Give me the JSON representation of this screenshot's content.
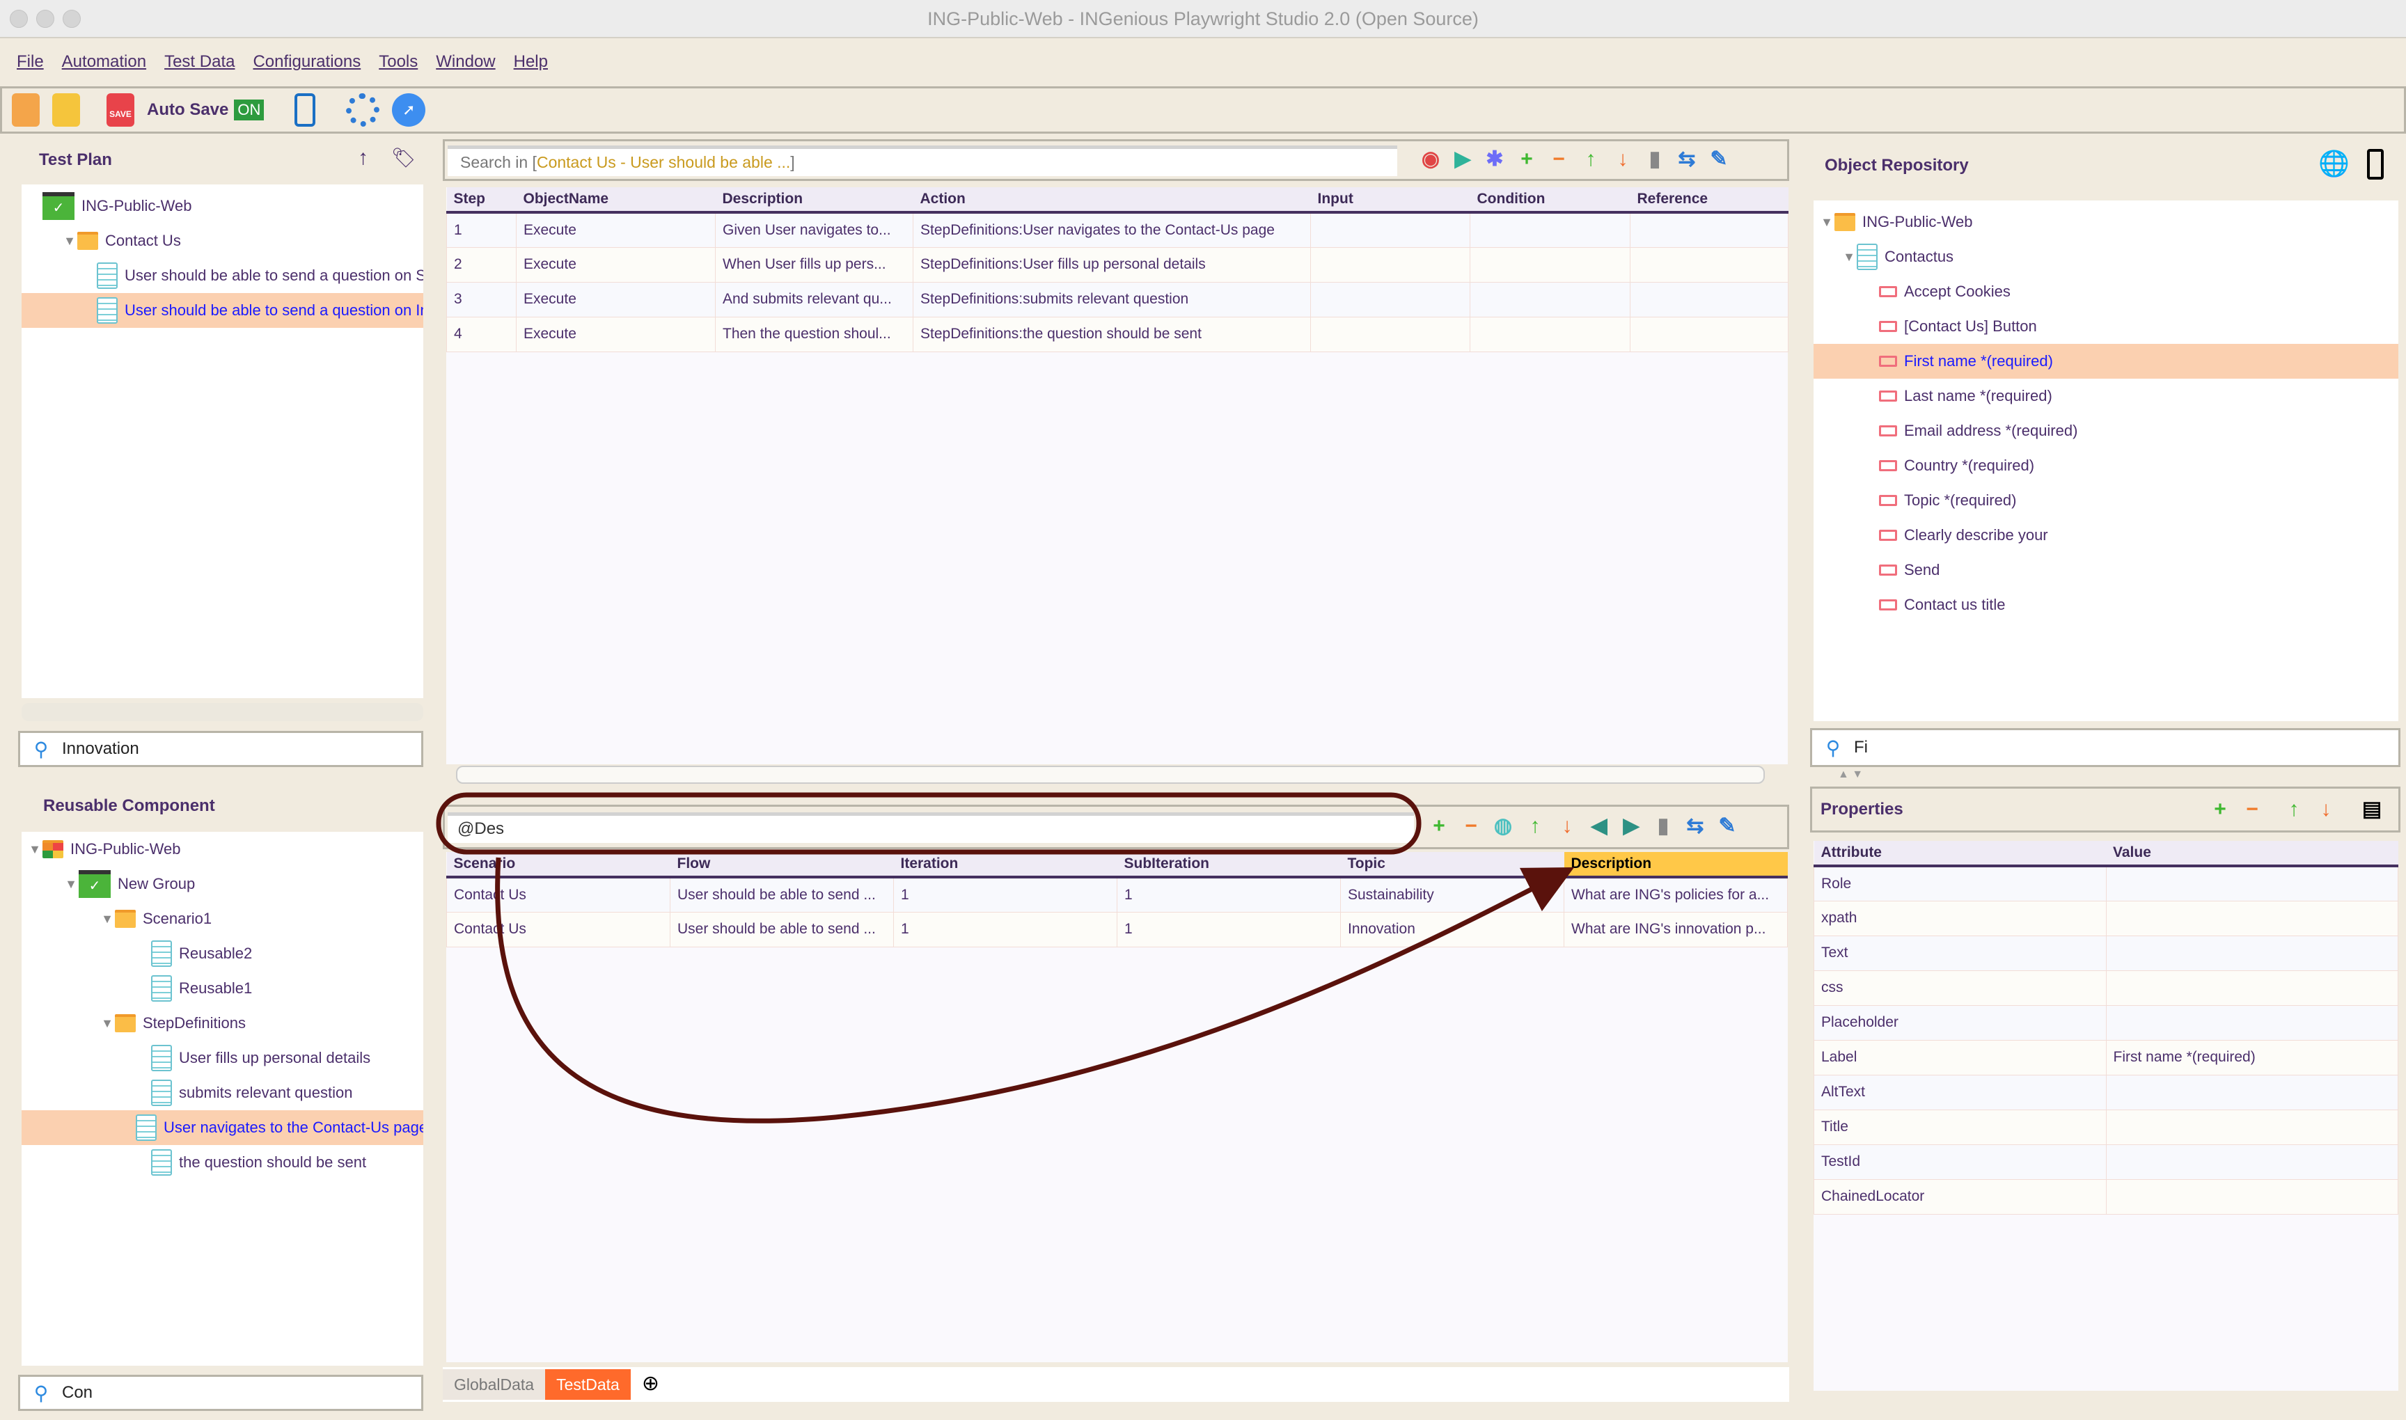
{
  "window": {
    "title": "ING-Public-Web - INGenious Playwright Studio 2.0 (Open Source)"
  },
  "menu": [
    "File",
    "Automation",
    "Test Data",
    "Configurations",
    "Tools",
    "Window",
    "Help"
  ],
  "toolbar": {
    "auto_save_label": "Auto Save",
    "auto_save_state": "ON",
    "icons": [
      "open-project-icon",
      "new-project-icon",
      "save-icon",
      "mobile-settings-icon",
      "settings-gear-icon",
      "inspector-cursor-icon"
    ]
  },
  "test_plan": {
    "title": "Test Plan",
    "tree": [
      {
        "label": "ING-Public-Web",
        "icon": "green-folder",
        "level": 0
      },
      {
        "label": "Contact Us",
        "icon": "folder",
        "level": 1,
        "expanded": true
      },
      {
        "label": "User should be able to send a question on Sustainability",
        "icon": "doc",
        "level": 2
      },
      {
        "label": "User should be able to send a question on Innovation",
        "icon": "doc",
        "level": 2,
        "selected": true
      }
    ],
    "search_value": "Innovation"
  },
  "reusable": {
    "title": "Reusable Component",
    "tree": [
      {
        "label": "ING-Public-Web",
        "icon": "component",
        "level": 0,
        "expanded": true
      },
      {
        "label": "New Group",
        "icon": "green-folder",
        "level": 1,
        "expanded": true
      },
      {
        "label": "Scenario1",
        "icon": "folder",
        "level": 2,
        "expanded": true
      },
      {
        "label": "Reusable2",
        "icon": "doc",
        "level": 3
      },
      {
        "label": "Reusable1",
        "icon": "doc",
        "level": 3
      },
      {
        "label": "StepDefinitions",
        "icon": "folder",
        "level": 2,
        "expanded": true
      },
      {
        "label": "User fills up personal details",
        "icon": "doc",
        "level": 3
      },
      {
        "label": "submits relevant question",
        "icon": "doc",
        "level": 3
      },
      {
        "label": "User navigates to the Contact-Us page",
        "icon": "doc",
        "level": 3,
        "selected": true
      },
      {
        "label": "the question should be sent",
        "icon": "doc",
        "level": 3
      }
    ],
    "search_value": "Con"
  },
  "test_case": {
    "search_prefix": "Search in [",
    "search_context": "Contact Us - User should be able ...",
    "search_suffix": "]",
    "columns": [
      "Step",
      "ObjectName",
      "Description",
      "Action",
      "Input",
      "Condition",
      "Reference"
    ],
    "rows": [
      [
        "1",
        "Execute",
        "Given  User navigates to...",
        "StepDefinitions:User navigates to the Contact-Us page",
        "",
        "",
        ""
      ],
      [
        "2",
        "Execute",
        "When  User fills up pers...",
        "StepDefinitions:User fills up personal details",
        "",
        "",
        ""
      ],
      [
        "3",
        "Execute",
        "And  submits relevant qu...",
        "StepDefinitions:submits relevant question",
        "",
        "",
        ""
      ],
      [
        "4",
        "Execute",
        "Then  the question shoul...",
        "StepDefinitions:the question should be sent",
        "",
        "",
        ""
      ]
    ]
  },
  "test_data": {
    "search_value": "@Des",
    "columns": [
      "Scenario",
      "Flow",
      "Iteration",
      "SubIteration",
      "Topic",
      "Description"
    ],
    "highlighted_column": "Description",
    "rows": [
      [
        "Contact Us",
        "User should be able to send ...",
        "1",
        "1",
        "Sustainability",
        "What are ING's policies for a..."
      ],
      [
        "Contact Us",
        "User should be able to send ...",
        "1",
        "1",
        "Innovation",
        "What are ING's innovation p..."
      ]
    ],
    "tabs": [
      {
        "label": "GlobalData"
      },
      {
        "label": "TestData",
        "active": true
      }
    ]
  },
  "object_repository": {
    "title": "Object Repository",
    "tree": [
      {
        "label": "ING-Public-Web",
        "icon": "folder",
        "level": 0,
        "expanded": true
      },
      {
        "label": "Contactus",
        "icon": "page",
        "level": 1,
        "expanded": true
      },
      {
        "label": "Accept Cookies",
        "icon": "obj",
        "level": 2
      },
      {
        "label": "[Contact Us] Button",
        "icon": "obj",
        "level": 2
      },
      {
        "label": "First name *(required)",
        "icon": "obj",
        "level": 2,
        "selected": true
      },
      {
        "label": "Last name *(required)",
        "icon": "obj",
        "level": 2
      },
      {
        "label": "Email address *(required)",
        "icon": "obj",
        "level": 2
      },
      {
        "label": "Country *(required)",
        "icon": "obj",
        "level": 2
      },
      {
        "label": "Topic *(required)",
        "icon": "obj",
        "level": 2
      },
      {
        "label": "Clearly describe your",
        "icon": "obj",
        "level": 2
      },
      {
        "label": "Send",
        "icon": "obj",
        "level": 2
      },
      {
        "label": "Contact us title",
        "icon": "obj",
        "level": 2
      }
    ],
    "search_value": "Fi"
  },
  "properties": {
    "title": "Properties",
    "columns": [
      "Attribute",
      "Value"
    ],
    "rows": [
      [
        "Role",
        ""
      ],
      [
        "xpath",
        ""
      ],
      [
        "Text",
        ""
      ],
      [
        "css",
        ""
      ],
      [
        "Placeholder",
        ""
      ],
      [
        "Label",
        "First name *(required)"
      ],
      [
        "AltText",
        ""
      ],
      [
        "Title",
        ""
      ],
      [
        "TestId",
        ""
      ],
      [
        "ChainedLocator",
        ""
      ]
    ]
  },
  "colors": {
    "accent_selection": "#fbd0b0",
    "highlight_column": "#ffc848",
    "annotation": "#5a120c",
    "active_tab": "#ff6a2b"
  }
}
